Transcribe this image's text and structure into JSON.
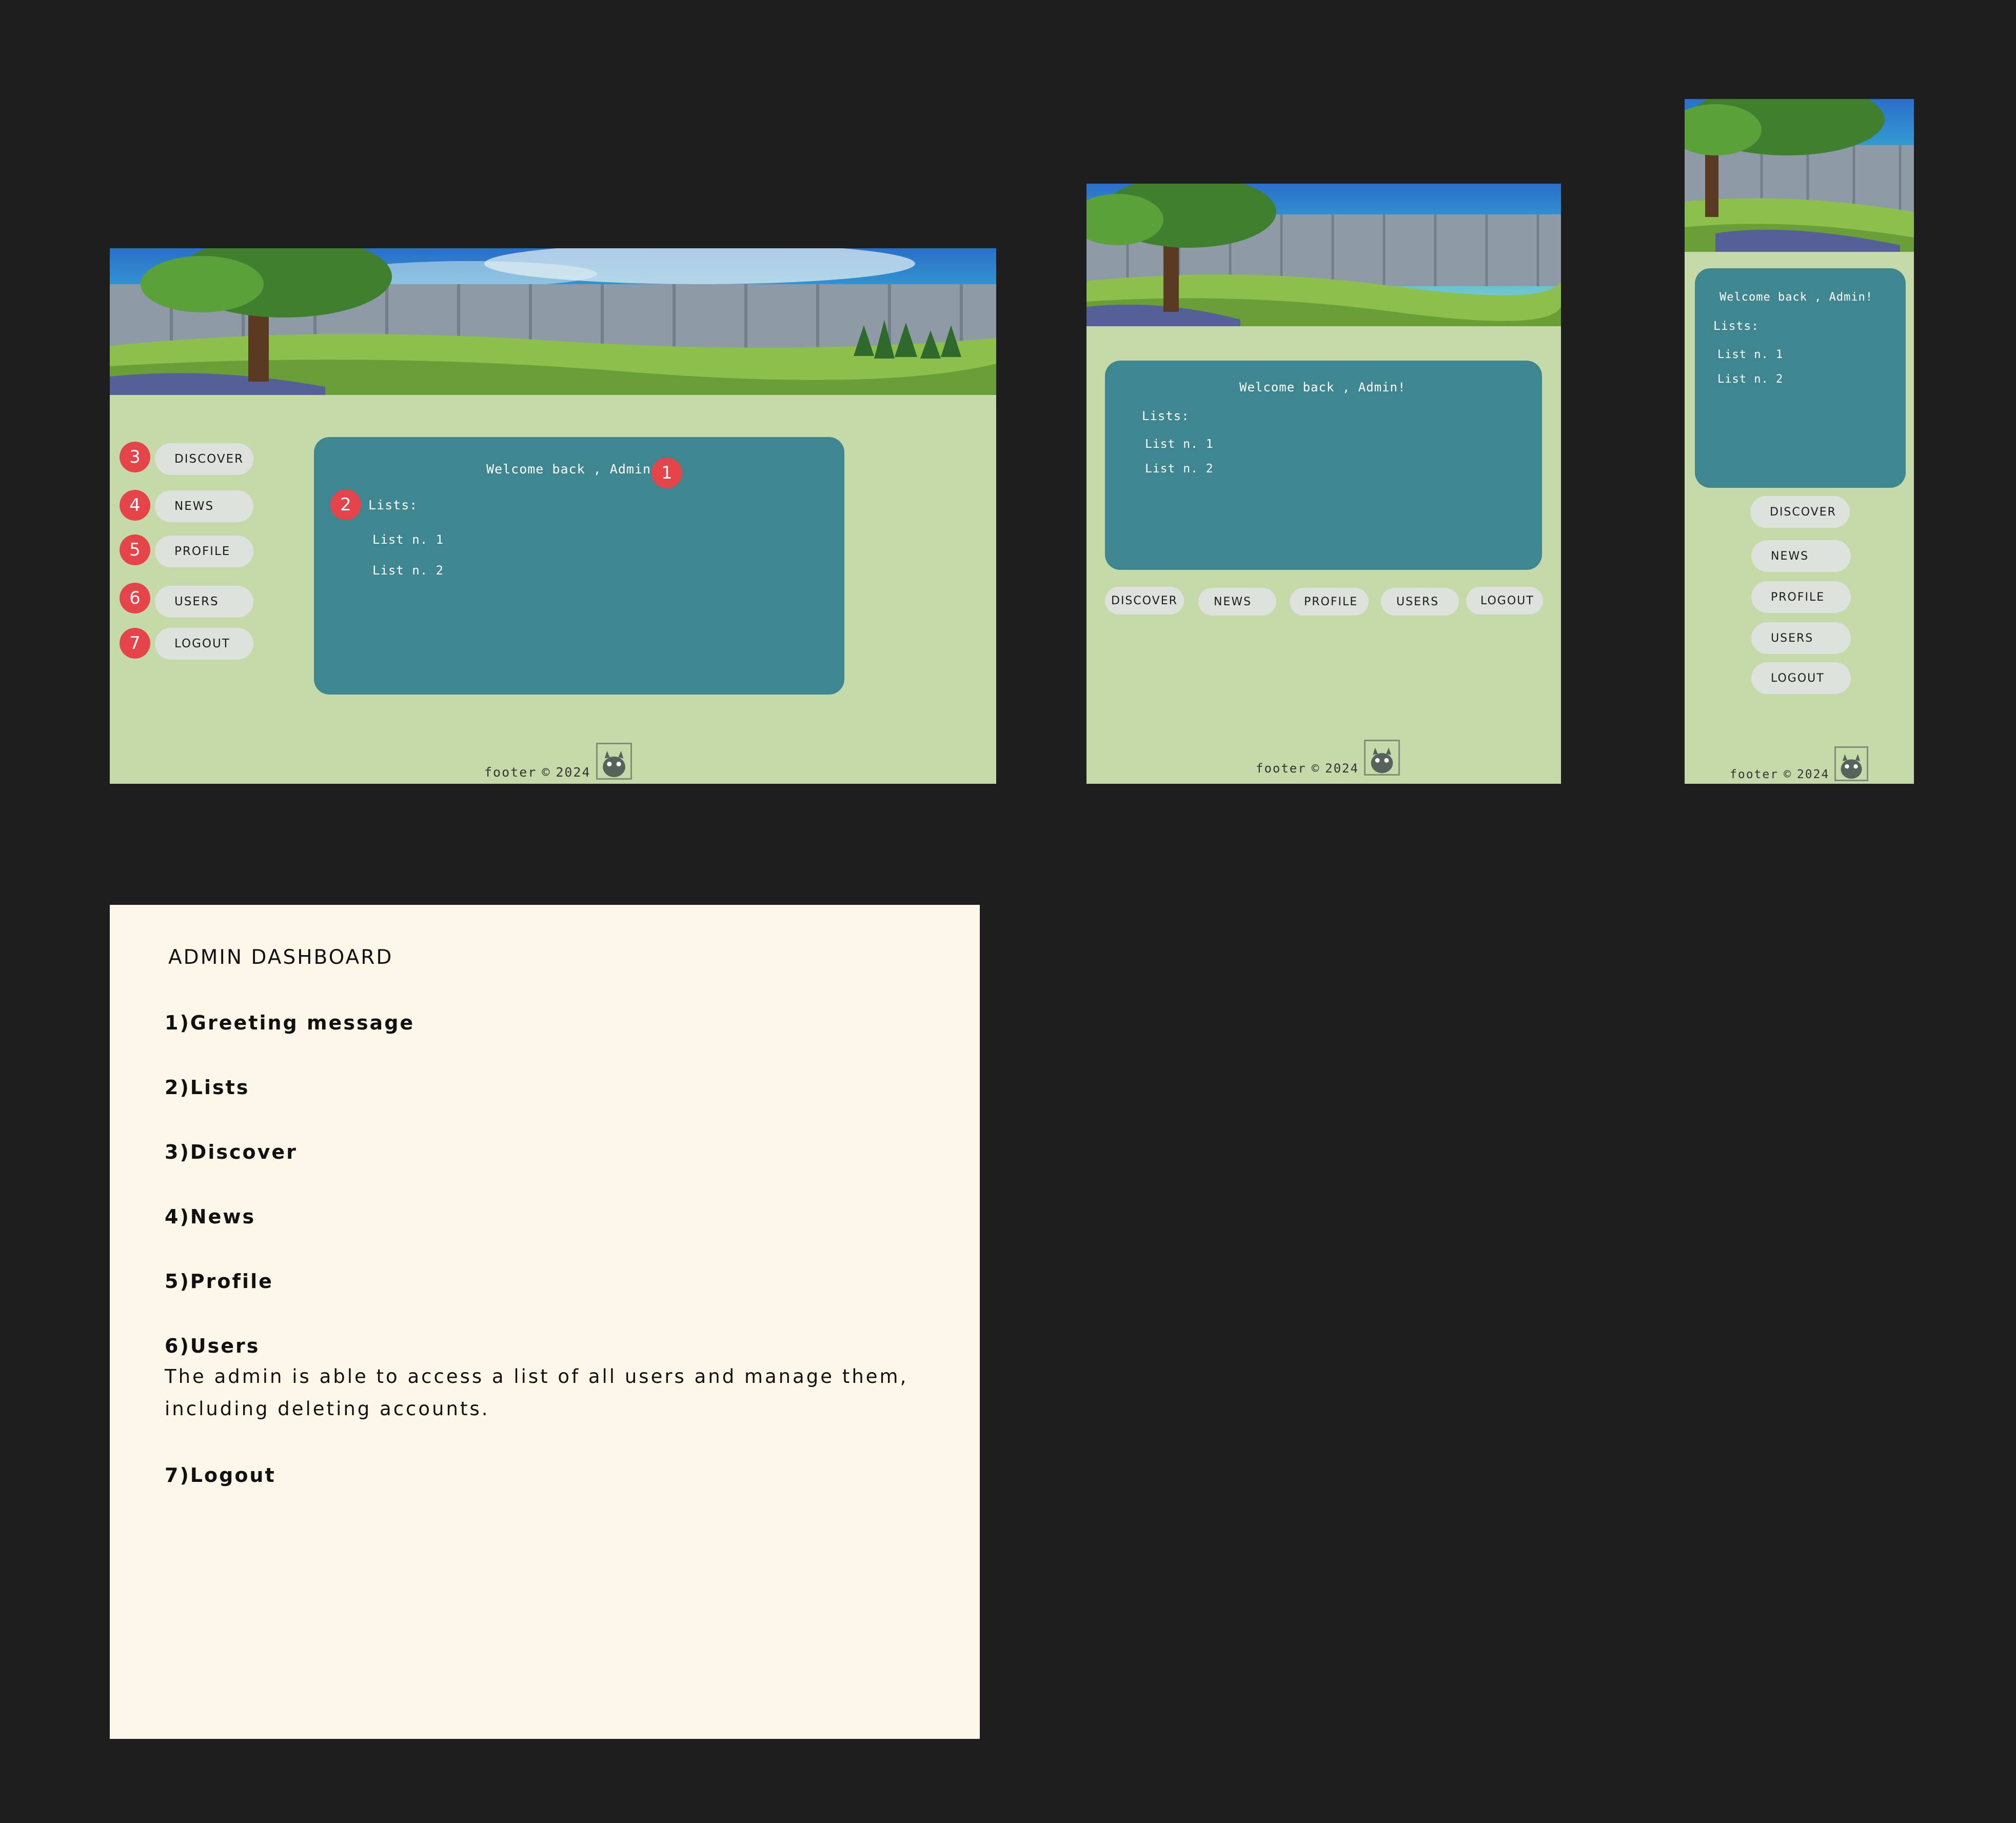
{
  "nav": [
    "DISCOVER",
    "NEWS",
    "PROFILE",
    "USERS",
    "LOGOUT"
  ],
  "card": {
    "greeting": "Welcome back , Admin!",
    "lists_label": "Lists:",
    "lists": [
      "List n. 1",
      "List n. 2"
    ]
  },
  "footer": {
    "text": "footer",
    "copyright": "©",
    "year": "2024"
  },
  "badges": [
    "1",
    "2",
    "3",
    "4",
    "5",
    "6",
    "7"
  ],
  "notes": {
    "title": "ADMIN DASHBOARD",
    "items": [
      "1)Greeting message",
      "2)Lists",
      "3)Discover",
      "4)News",
      "5)Profile",
      "6)Users",
      "7)Logout"
    ],
    "users_description": "The admin is able to access a list of all users and manage them, including deleting accounts."
  },
  "colors": {
    "background": "#1e1e1e",
    "frame": "#c6d9a9",
    "card": "#3e8690",
    "pill": "#dde3dc",
    "badge": "#e4444a",
    "notes": "#fdf7ea"
  },
  "icons": {
    "mascot": "totoro-mascot-icon"
  }
}
